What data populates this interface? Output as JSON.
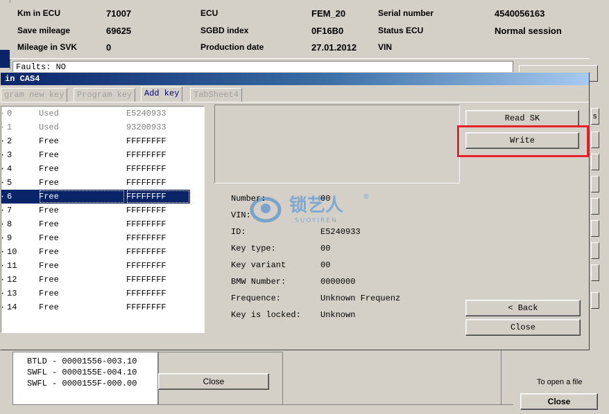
{
  "info": {
    "km_in_ecu_label": "Km in ECU",
    "km_in_ecu_value": "71007",
    "save_mileage_label": "Save mileage",
    "save_mileage_value": "69625",
    "mileage_svk_label": "Mileage in SVK",
    "mileage_svk_value": "0",
    "ecu_label": "ECU",
    "ecu_value": "FEM_20",
    "sgbd_label": "SGBD index",
    "sgbd_value": "0F16B0",
    "prod_date_label": "Production date",
    "prod_date_value": "27.01.2012",
    "serial_label": "Serial number",
    "serial_value": "4540056163",
    "status_label": "Status ECU",
    "status_value": "Normal session",
    "vin_label": "VIN",
    "vin_value": ""
  },
  "faults_text": "Faults: NO",
  "dialog": {
    "title": "in CAS4",
    "tabs": [
      {
        "label": "gram new key",
        "active": false
      },
      {
        "label": "Program key",
        "active": false
      },
      {
        "label": "Add key",
        "active": true
      },
      {
        "label": "TabSheet4",
        "active": false
      }
    ],
    "keys": [
      {
        "num": "0",
        "state": "Used",
        "value": "E5240933"
      },
      {
        "num": "1",
        "state": "Used",
        "value": "93200933"
      },
      {
        "num": "2",
        "state": "Free",
        "value": "FFFFFFFF"
      },
      {
        "num": "3",
        "state": "Free",
        "value": "FFFFFFFF"
      },
      {
        "num": "4",
        "state": "Free",
        "value": "FFFFFFFF"
      },
      {
        "num": "5",
        "state": "Free",
        "value": "FFFFFFFF"
      },
      {
        "num": "6",
        "state": "Free",
        "value": "FFFFFFFF"
      },
      {
        "num": "7",
        "state": "Free",
        "value": "FFFFFFFF"
      },
      {
        "num": "8",
        "state": "Free",
        "value": "FFFFFFFF"
      },
      {
        "num": "9",
        "state": "Free",
        "value": "FFFFFFFF"
      },
      {
        "num": "10",
        "state": "Free",
        "value": "FFFFFFFF"
      },
      {
        "num": "11",
        "state": "Free",
        "value": "FFFFFFFF"
      },
      {
        "num": "12",
        "state": "Free",
        "value": "FFFFFFFF"
      },
      {
        "num": "13",
        "state": "Free",
        "value": "FFFFFFFF"
      },
      {
        "num": "14",
        "state": "Free",
        "value": "FFFFFFFF"
      }
    ],
    "selected_key": "6",
    "details": {
      "number_label": "Number:",
      "number_value": "00",
      "vin_label": "VIN:",
      "vin_value": "",
      "id_label": "ID:",
      "id_value": "E5240933",
      "keytype_label": "Key type:",
      "keytype_value": "00",
      "keyvariant_label": "Key variant",
      "keyvariant_value": "00",
      "bmwnum_label": "BMW Number:",
      "bmwnum_value": "0000000",
      "freq_label": "Frequence:",
      "freq_value": "Unknown Frequenz",
      "locked_label": "Key is locked:",
      "locked_value": "Unknown"
    },
    "buttons": {
      "read_sk": "Read SK",
      "write": "Write",
      "back": "< Back",
      "close": "Close"
    },
    "watermark_text": "锁艺人",
    "watermark_sub": "SUOYIREN",
    "watermark_reg": "®"
  },
  "background": {
    "versions": [
      "BTLD - 00001556-003.10",
      "SWFL - 0000155E-004.10",
      "SWFL - 0000155F-000.00"
    ],
    "close_mid": "Close",
    "open_file_text": "To open a file",
    "close_right": "Close",
    "right_btn_partial": "s"
  },
  "colors": {
    "highlight": "#e8202a",
    "selection": "#0a246a",
    "title_bar": "#0a246a"
  }
}
